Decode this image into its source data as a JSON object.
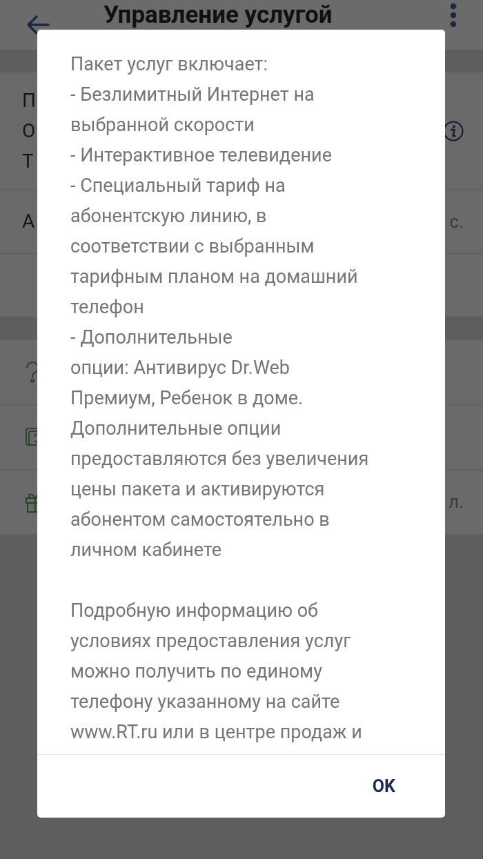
{
  "app_bar": {
    "title": "Управление услугой"
  },
  "background_sections": [
    {
      "rows": [
        {
          "kind": "title",
          "fragments": [
            "П",
            "О",
            "Т"
          ]
        },
        {
          "kind": "value",
          "fragments": [
            "А"
          ],
          "trailing": "с."
        },
        {
          "kind": "empty"
        }
      ]
    },
    {
      "rows": [
        {
          "kind": "link"
        },
        {
          "kind": "link"
        },
        {
          "kind": "link",
          "trailing": "л."
        }
      ]
    }
  ],
  "dialog": {
    "paragraphs": [
      "Пакет услуг включает:\n- Безлимитный Интернет на\nвыбранной скорости\n- Интерактивное телевидение\n- Специальный тариф на\nабонентскую линию, в\nсоответствии с выбранным\nтарифным планом на домашний\nтелефон\n- Дополнительные\nопции: Антивирус Dr.Web\nПремиум, Ребенок в доме.\nДополнительные опции\nпредоставляются без увеличения\nцены пакета и активируются\nабонентом самостоятельно в\nличном кабинете",
      "Подробную информацию об\nусловиях предоставления услуг\nможно получить по единому\nтелефону указанному на сайте\nwww.RT.ru или в центре продаж и"
    ],
    "button": "OK"
  }
}
